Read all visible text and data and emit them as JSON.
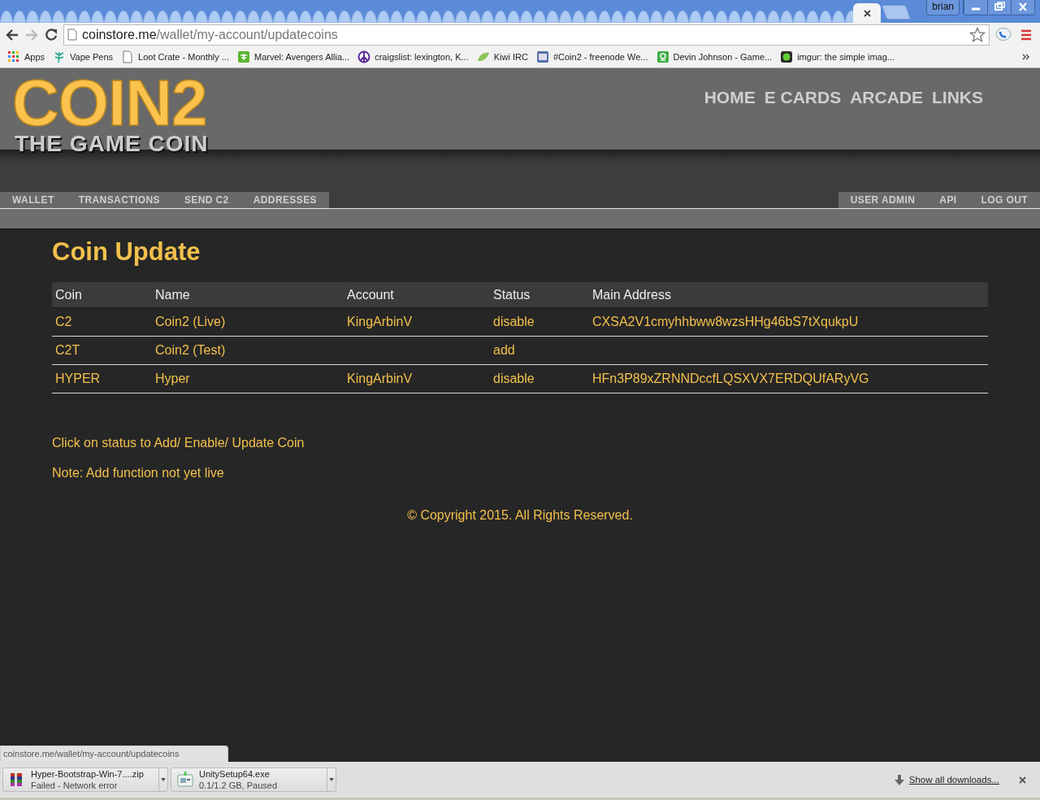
{
  "window": {
    "user": "brian"
  },
  "address_bar": {
    "host": "coinstore.me",
    "path": "/wallet/my-account/updatecoins"
  },
  "bookmarks": [
    {
      "label": "Apps"
    },
    {
      "label": "Vape Pens"
    },
    {
      "label": "Loot Crate - Monthly ..."
    },
    {
      "label": "Marvel: Avengers Allia..."
    },
    {
      "label": "craigslist: lexington, K..."
    },
    {
      "label": "Kiwi IRC"
    },
    {
      "label": "#Coin2 - freenode We..."
    },
    {
      "label": "Devin Johnson - Game..."
    },
    {
      "label": "imgur: the simple imag..."
    }
  ],
  "site": {
    "logo_title": "COIN2",
    "logo_subtitle": "THE GAME COIN",
    "top_nav": [
      "HOME",
      "E CARDS",
      "ARCADE",
      "LINKS"
    ],
    "left_nav": [
      "WALLET",
      "TRANSACTIONS",
      "SEND C2",
      "ADDRESSES"
    ],
    "right_nav": [
      "USER ADMIN",
      "API",
      "LOG OUT"
    ]
  },
  "page": {
    "heading": "Coin Update",
    "table": {
      "columns": [
        "Coin",
        "Name",
        "Account",
        "Status",
        "Main Address"
      ],
      "rows": [
        {
          "coin": "C2",
          "name": "Coin2 (Live)",
          "account": "KingArbinV",
          "status": "disable",
          "address": "CXSA2V1cmyhhbww8wzsHHg46bS7tXqukpU"
        },
        {
          "coin": "C2T",
          "name": "Coin2 (Test)",
          "status": "add"
        },
        {
          "coin": "HYPER",
          "name": "Hyper",
          "account": "KingArbinV",
          "status": "disable",
          "address": "HFn3P89xZRNNDccfLQSXVX7ERDQUfARyVG"
        }
      ]
    },
    "notes": [
      "Click on status to Add/ Enable/ Update Coin",
      "Note: Add function not yet live"
    ],
    "copyright": "© Copyright 2015. All Rights Reserved."
  },
  "status_url": "coinstore.me/wallet/my-account/updatecoins",
  "downloads": {
    "items": [
      {
        "name": "Hyper-Bootstrap-Win-7....zip",
        "status": "Failed - Network error"
      },
      {
        "name": "UnitySetup64.exe",
        "status": "0.1/1.2 GB, Paused"
      }
    ],
    "show_all": "Show all downloads..."
  }
}
